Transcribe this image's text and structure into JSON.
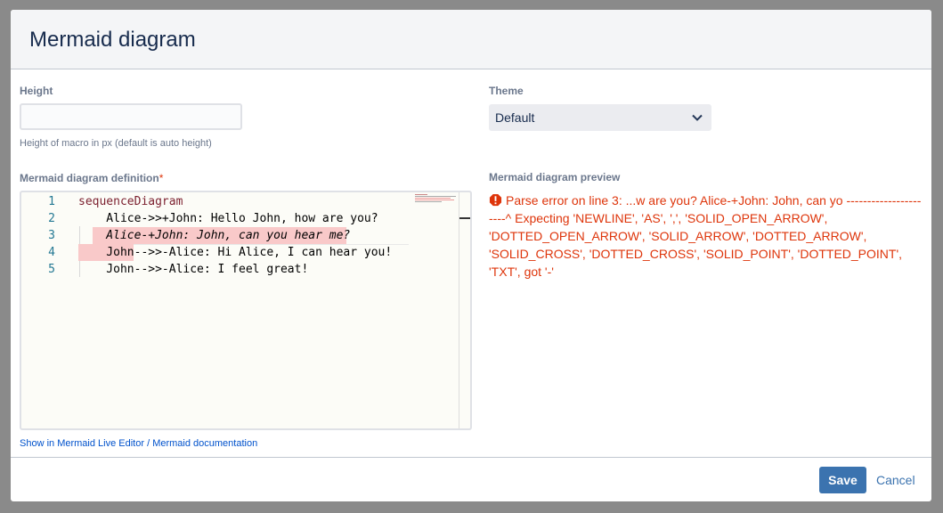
{
  "dialog": {
    "title": "Mermaid diagram"
  },
  "height": {
    "label": "Height",
    "value": "",
    "placeholder": "",
    "hint": "Height of macro in px (default is auto height)"
  },
  "theme": {
    "label": "Theme",
    "selected": "Default"
  },
  "definition": {
    "label": "Mermaid diagram definition",
    "required_mark": "*",
    "lines": [
      {
        "num": "1",
        "text": "sequenceDiagram"
      },
      {
        "num": "2",
        "text": "    Alice->>+John: Hello John, how are you?"
      },
      {
        "num": "3",
        "text": "    Alice-+John: John, can you hear me?"
      },
      {
        "num": "4",
        "text": "    John-->>-Alice: Hi Alice, I can hear you!"
      },
      {
        "num": "5",
        "text": "    John-->>-Alice: I feel great!"
      }
    ]
  },
  "links": {
    "live_editor": "Show in Mermaid Live Editor",
    "separator": " / ",
    "documentation": "Mermaid documentation"
  },
  "preview": {
    "label": "Mermaid diagram preview",
    "error": "Parse error on line 3: ...w are you? Alice-+John: John, can yo ----------------------^ Expecting 'NEWLINE', 'AS', ',', 'SOLID_OPEN_ARROW', 'DOTTED_OPEN_ARROW', 'SOLID_ARROW', 'DOTTED_ARROW', 'SOLID_CROSS', 'DOTTED_CROSS', 'SOLID_POINT', 'DOTTED_POINT', 'TXT', got '-'"
  },
  "footer": {
    "save": "Save",
    "cancel": "Cancel"
  },
  "colors": {
    "primary": "#3b73af",
    "error": "#de350b",
    "error_highlight": "#f9c9c9"
  }
}
